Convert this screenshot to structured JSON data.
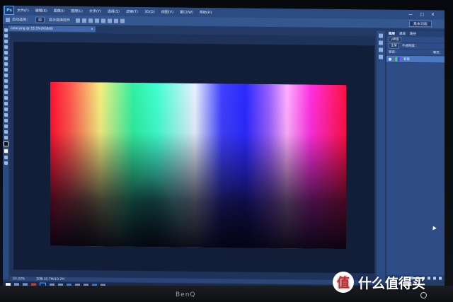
{
  "menu": {
    "logo": "Ps",
    "items": [
      "文件(F)",
      "编辑(E)",
      "图像(I)",
      "图层(L)",
      "文字(Y)",
      "选择(S)",
      "滤镜(T)",
      "3D(D)",
      "视图(V)",
      "窗口(W)",
      "帮助(H)"
    ],
    "window_buttons": [
      "—",
      "□",
      "✕"
    ]
  },
  "options": {
    "auto_select_label": "自动选择：",
    "auto_select_value": "组",
    "show_transform": "显示变换控件",
    "workspace": "基本功能"
  },
  "document": {
    "tab_title": "color.png @ 33.3%(RGB/8)",
    "tab_close": "×"
  },
  "status": {
    "zoom": "33.33%",
    "doc_info": "文档:10.7M/10.7M"
  },
  "layers_panel": {
    "tabs": [
      "图层",
      "通道",
      "路径"
    ],
    "kind_label": "ρ类型",
    "blend_mode": "正常",
    "opacity_label": "不透明度：",
    "lock_label": "锁定：",
    "fill_label": "填充：",
    "layer_name": "背景"
  },
  "taskbar": {
    "tray_time": ""
  },
  "monitor": {
    "brand": "BenQ"
  },
  "watermark": {
    "logo_char": "值",
    "text": "什么值得买"
  }
}
